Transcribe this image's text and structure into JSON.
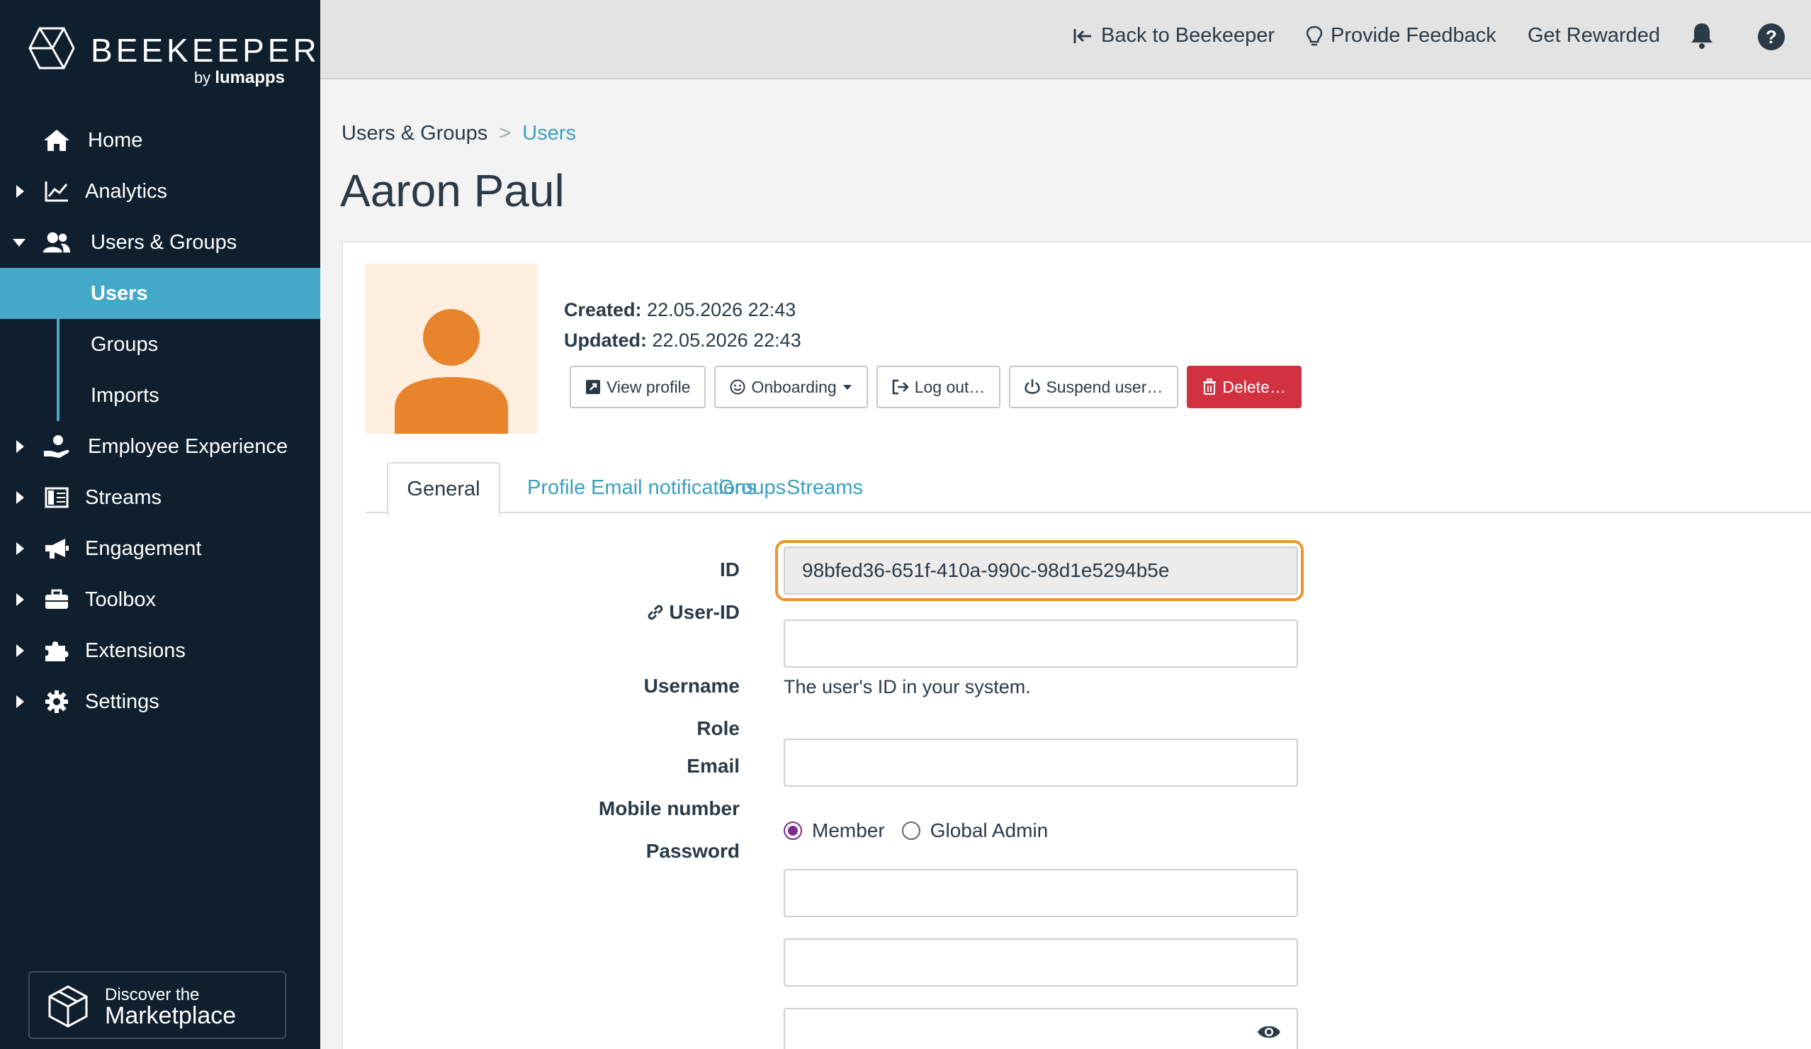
{
  "brand": {
    "name": "BEEKEEPER",
    "by": "by",
    "partner": "lumapps"
  },
  "sidebar": {
    "items": [
      {
        "label": "Home"
      },
      {
        "label": "Analytics"
      },
      {
        "label": "Users & Groups"
      },
      {
        "label": "Employee Experience"
      },
      {
        "label": "Streams"
      },
      {
        "label": "Engagement"
      },
      {
        "label": "Toolbox"
      },
      {
        "label": "Extensions"
      },
      {
        "label": "Settings"
      }
    ],
    "subitems": [
      {
        "label": "Users",
        "active": true
      },
      {
        "label": "Groups"
      },
      {
        "label": "Imports"
      }
    ],
    "marketplace": {
      "line1": "Discover the",
      "line2": "Marketplace"
    }
  },
  "topbar": {
    "back": "Back to Beekeeper",
    "feedback": "Provide Feedback",
    "rewarded": "Get Rewarded"
  },
  "breadcrumb": {
    "parent": "Users & Groups",
    "separator": ">",
    "current": "Users"
  },
  "page": {
    "title": "Aaron Paul"
  },
  "user": {
    "created_label": "Created:",
    "created_value": "22.05.2026 22:43",
    "updated_label": "Updated:",
    "updated_value": "22.05.2026 22:43"
  },
  "actions": {
    "view_profile": "View profile",
    "onboarding": "Onboarding",
    "logout": "Log out…",
    "suspend": "Suspend user…",
    "delete": "Delete…"
  },
  "tabs": [
    "General",
    "Profile",
    "Email notifications",
    "Groups",
    "Streams"
  ],
  "form": {
    "id_label": "ID",
    "id_value": "98bfed36-651f-410a-990c-98d1e5294b5e",
    "userid_label": "User-ID",
    "userid_value": "",
    "userid_help": "The user's ID in your system.",
    "username_label": "Username",
    "username_value": "",
    "role_label": "Role",
    "role_options": [
      "Member",
      "Global Admin"
    ],
    "role_selected": "Member",
    "email_label": "Email",
    "email_value": "",
    "mobile_label": "Mobile number",
    "mobile_value": "",
    "password_label": "Password",
    "password_value": ""
  },
  "colors": {
    "sidebar_bg": "#0f1f2e",
    "active_nav": "#44a8c9",
    "link": "#3d9fbf",
    "danger": "#d2313f",
    "focus": "#f0922b",
    "avatar_bg": "#fdeee0",
    "avatar_fg": "#e8842c",
    "radio": "#7b2d8e"
  }
}
